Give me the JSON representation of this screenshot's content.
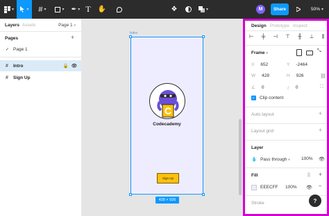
{
  "toolbar": {
    "main_menu_icon": "figma-menu-icon",
    "share_label": "Share",
    "avatar_initial": "M",
    "zoom": "50%"
  },
  "left_panel": {
    "tabs": [
      "Layers",
      "Assets"
    ],
    "page_selector": "Page 1",
    "pages_header": "Pages",
    "pages": [
      "Page 1"
    ],
    "layers": [
      "Intro",
      "Sign Up"
    ]
  },
  "canvas": {
    "frame_label": "Intro",
    "brand_text": "Codecademy",
    "button_text": "Sign Up",
    "size_badge": "428 × 926",
    "frame_fill": "#EEECFF"
  },
  "right_panel": {
    "tabs": [
      "Design",
      "Prototype",
      "Inspect"
    ],
    "frame_section": "Frame",
    "x_label": "X",
    "x_value": "652",
    "y_label": "Y",
    "y_value": "-2464",
    "w_label": "W",
    "w_value": "428",
    "h_label": "H",
    "h_value": "926",
    "rotation_value": "0",
    "radius_value": "0",
    "clip_content": "Clip content",
    "auto_layout": "Auto layout",
    "layout_grid": "Layout grid",
    "layer_section": "Layer",
    "blend_mode": "Pass through",
    "layer_opacity": "100%",
    "fill_section": "Fill",
    "fill_hex": "EEECFF",
    "fill_opacity": "100%",
    "stroke_section": "Stroke",
    "help_label": "?"
  },
  "colors": {
    "accent": "#0d99ff",
    "highlight_border": "#d400d4",
    "button_yellow": "#ffc107"
  }
}
